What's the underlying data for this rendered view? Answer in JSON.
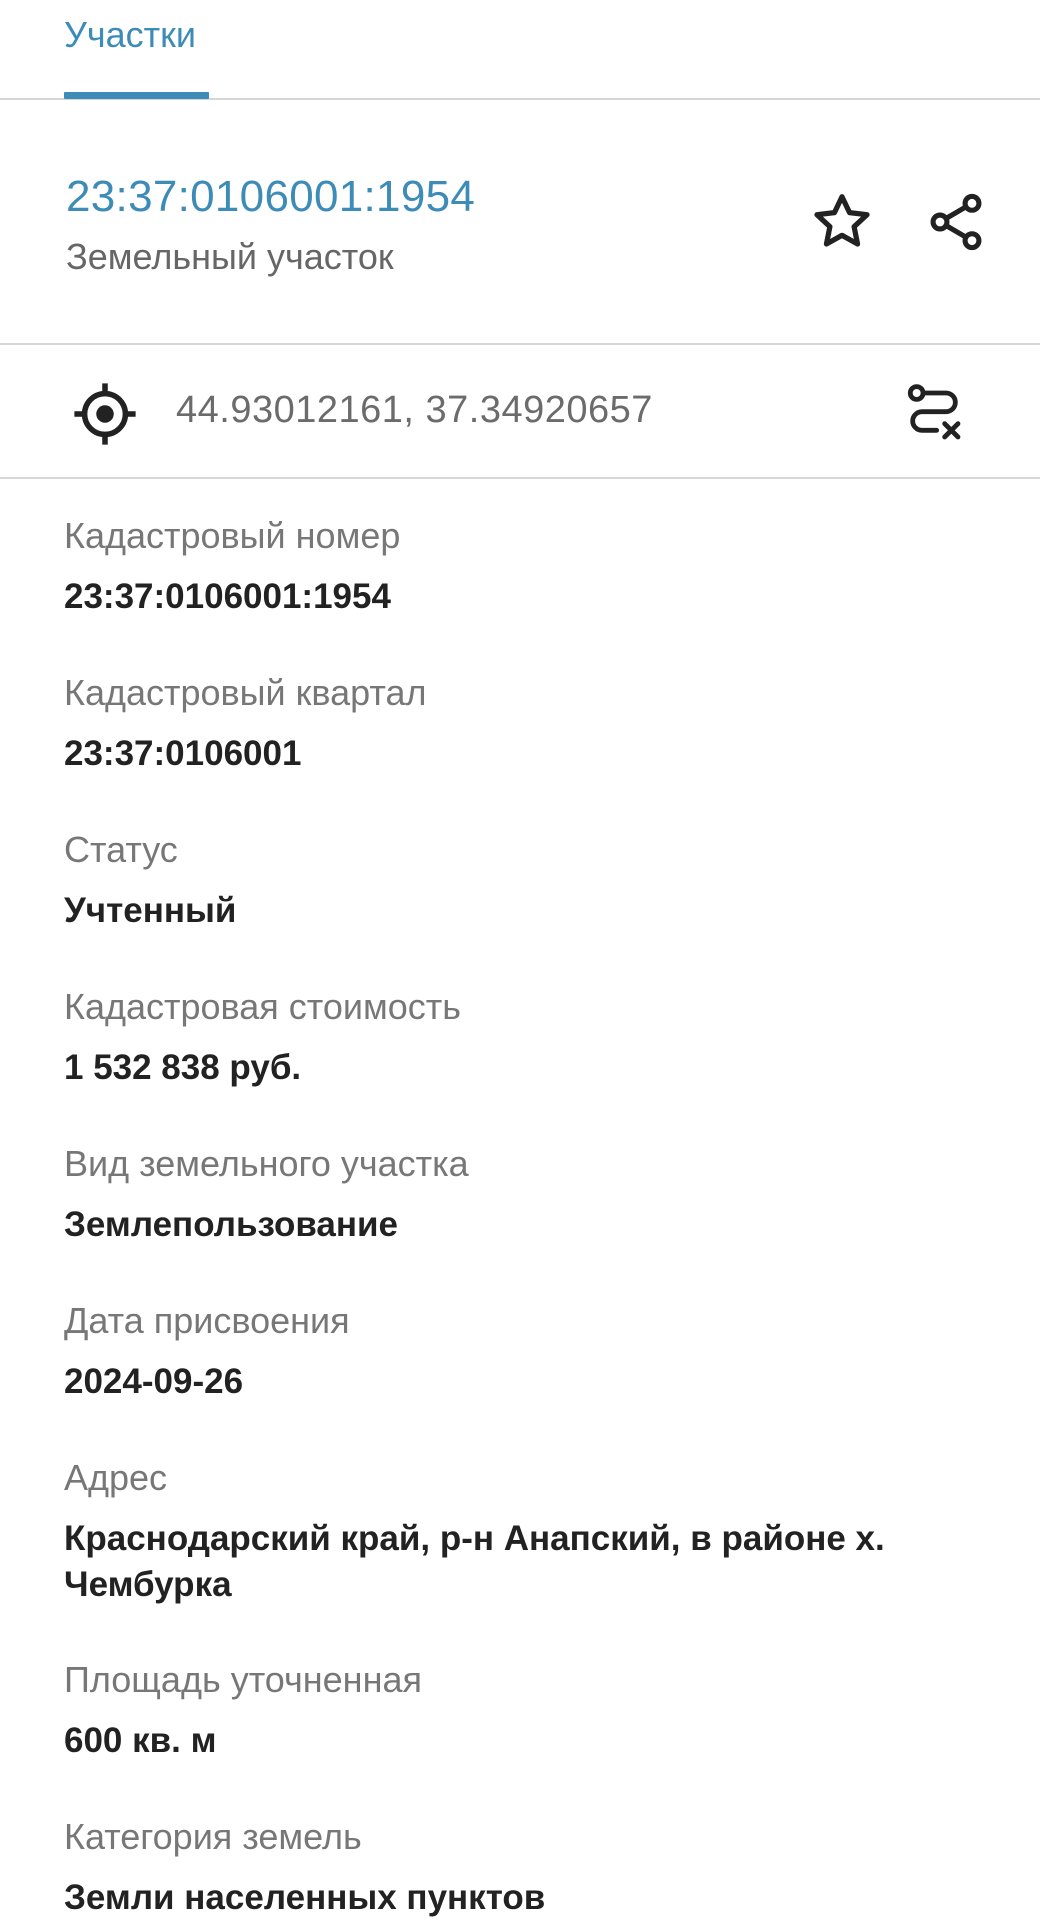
{
  "colors": {
    "accent": "#3d8bb7",
    "divider": "#d6d6d6",
    "label": "#777777",
    "value": "#222222"
  },
  "tabs": [
    {
      "label": "Участки",
      "active": true
    }
  ],
  "header": {
    "cadastral_number": "23:37:0106001:1954",
    "object_type": "Земельный участок",
    "favorite_icon": "star-outline-icon",
    "share_icon": "share-icon"
  },
  "coordinates": {
    "locate_icon": "gps-crosshair-icon",
    "value": "44.93012161, 37.34920657",
    "route_icon": "route-clear-icon"
  },
  "properties": [
    {
      "label": "Кадастровый номер",
      "value": "23:37:0106001:1954"
    },
    {
      "label": "Кадастровый квартал",
      "value": "23:37:0106001"
    },
    {
      "label": "Статус",
      "value": "Учтенный"
    },
    {
      "label": "Кадастровая стоимость",
      "value": "1 532 838 руб."
    },
    {
      "label": "Вид земельного участка",
      "value": "Землепользование"
    },
    {
      "label": "Дата присвоения",
      "value": "2024-09-26"
    },
    {
      "label": "Адрес",
      "value": "Краснодарский край, р-н Анапский, в районе х. Чембурка"
    },
    {
      "label": "Площадь уточненная",
      "value": "600 кв. м"
    },
    {
      "label": "Категория земель",
      "value": "Земли населенных пунктов"
    }
  ]
}
